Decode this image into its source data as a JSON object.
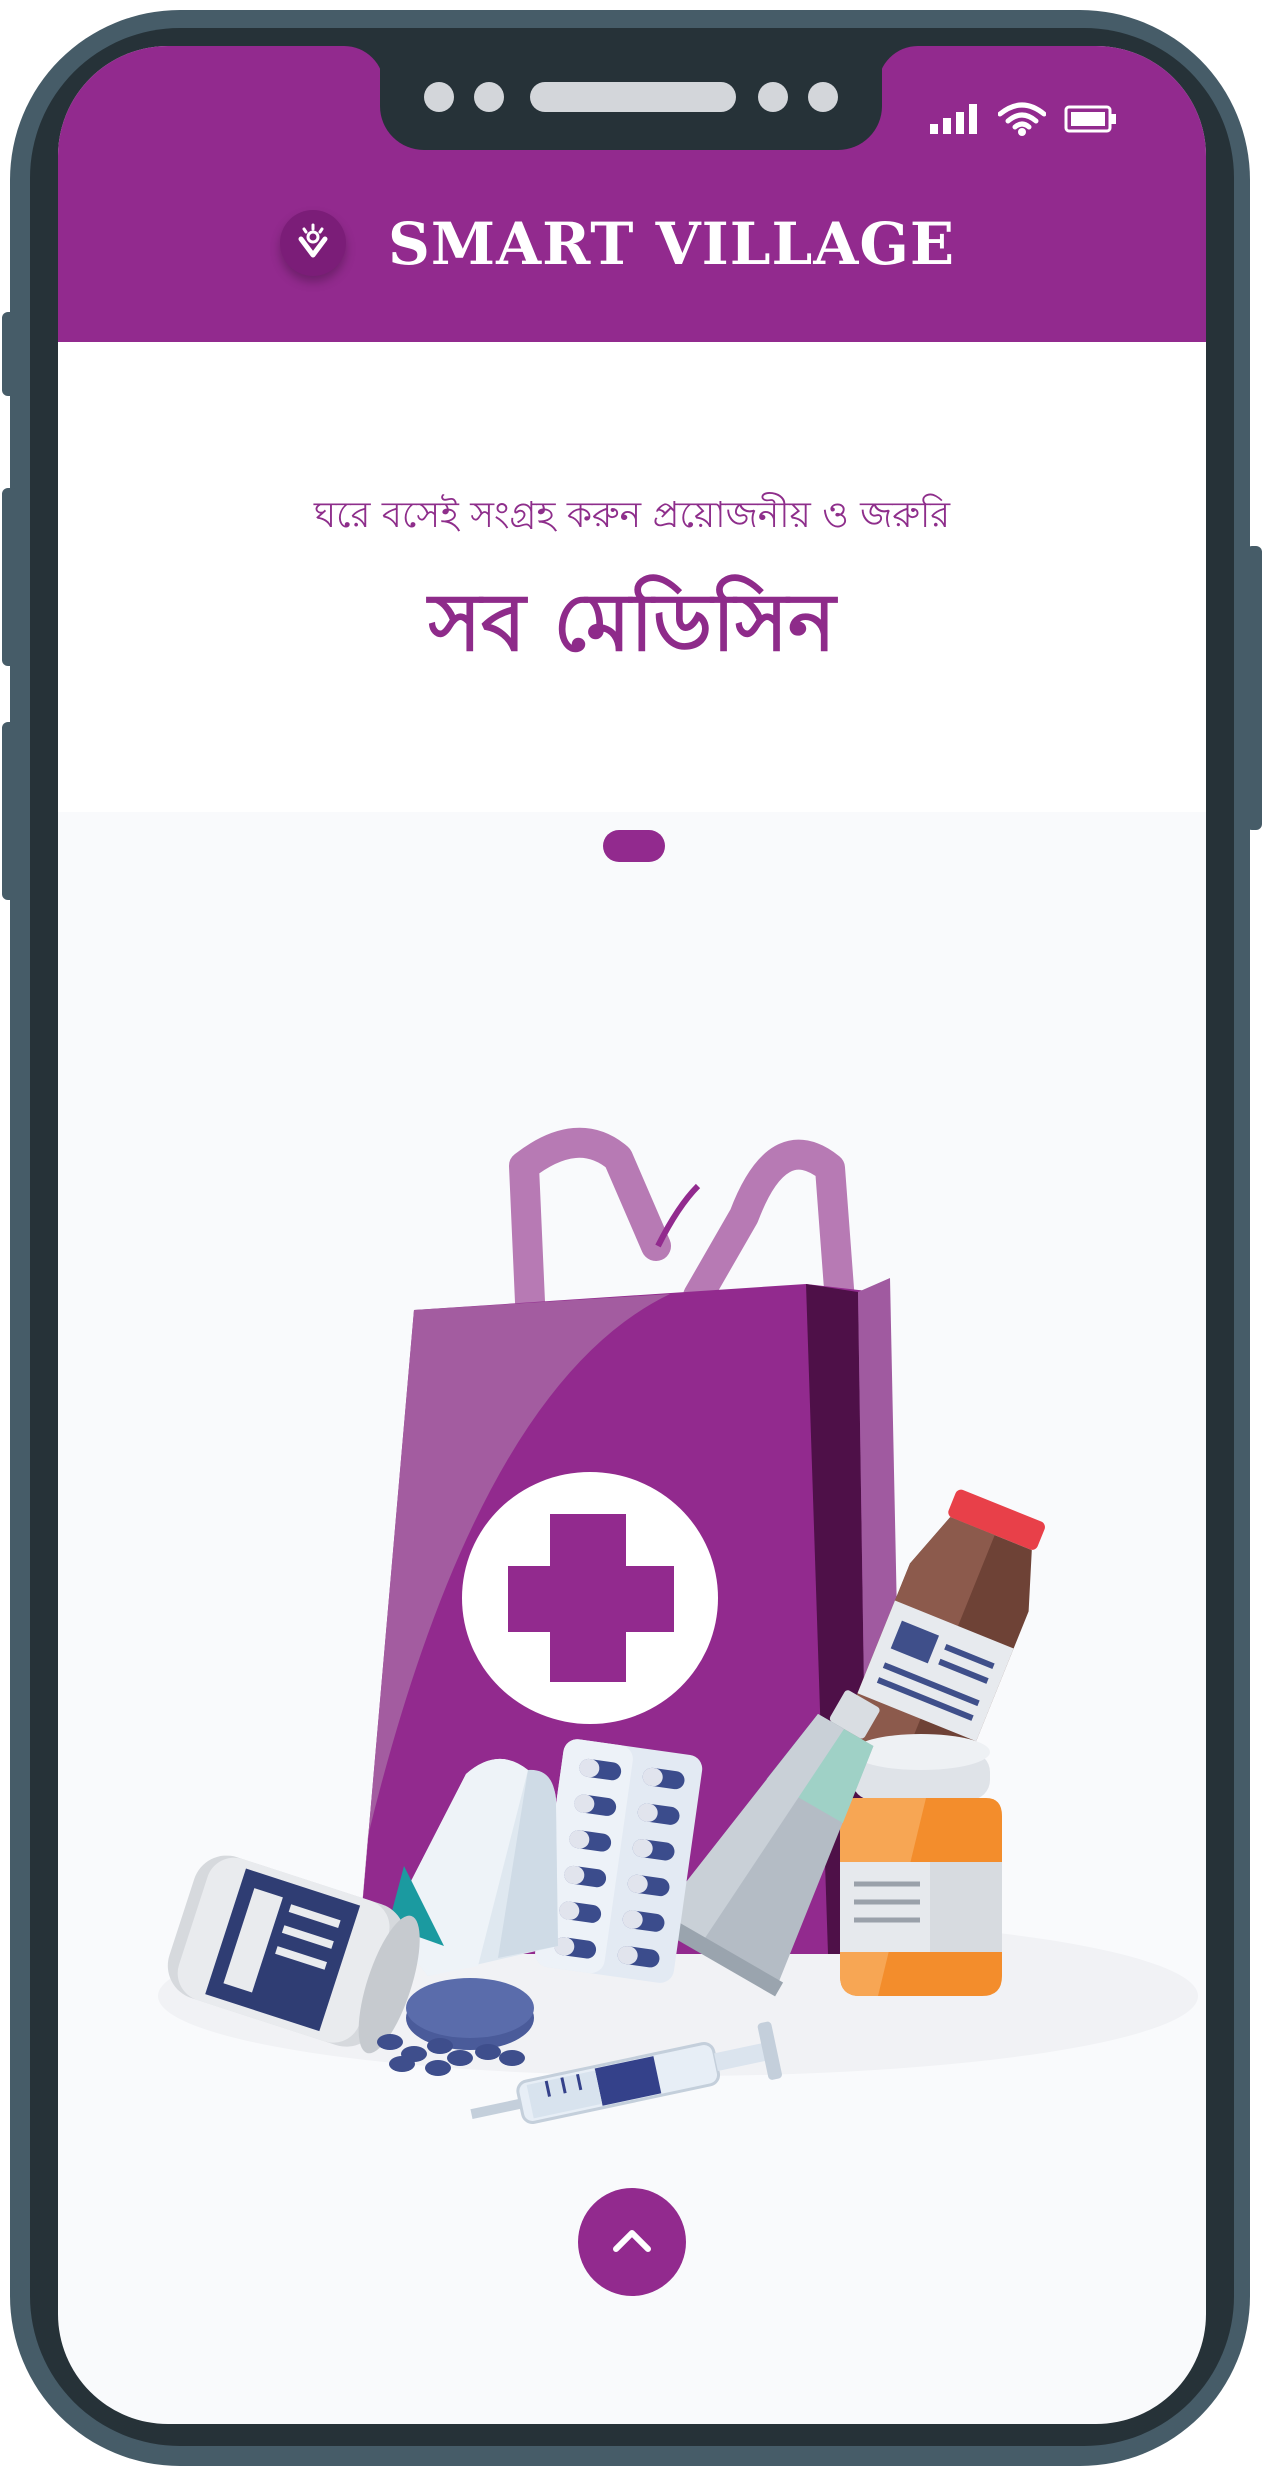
{
  "header": {
    "brand_name": "SMART VILLAGE",
    "logo_icon": "hand-flower-logo-icon",
    "background_color": "#922a8e"
  },
  "status_bar": {
    "icons": [
      "signal-icon",
      "wifi-icon",
      "battery-icon"
    ]
  },
  "main": {
    "subtitle": "ঘরে বসেই সংগ্রহ করুন প্রয়োজনীয় ও জরুরি",
    "title": "সব মেডিসিন",
    "accent_color": "#922a8e"
  },
  "carousel": {
    "indicator_icon": "page-indicator-pill"
  },
  "illustration": {
    "subject": "medicine-shopping-bag-illustration"
  },
  "footer": {
    "scroll_button_icon": "chevron-up-icon"
  }
}
